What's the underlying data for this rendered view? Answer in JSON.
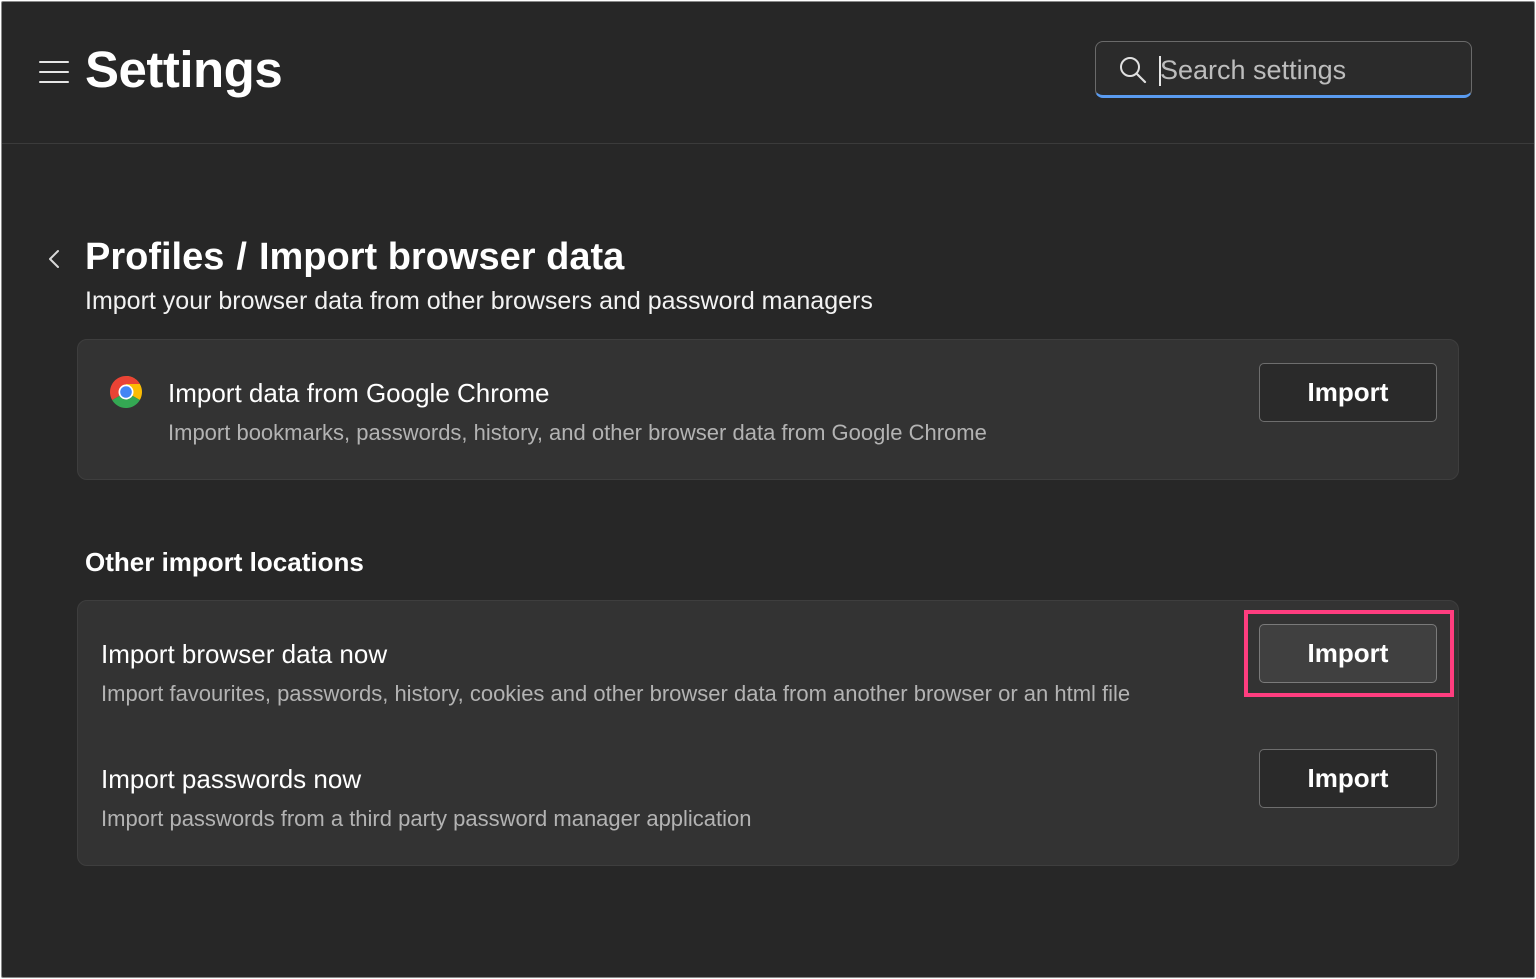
{
  "header": {
    "title": "Settings",
    "search": {
      "placeholder": "Search settings",
      "value": ""
    }
  },
  "page": {
    "breadcrumb": {
      "parent": "Profiles",
      "separator": "/",
      "current": "Import browser data"
    },
    "subtitle": "Import your browser data from other browsers and password managers"
  },
  "chrome_import": {
    "title": "Import data from Google Chrome",
    "description": "Import bookmarks, passwords, history, and other browser data from Google Chrome",
    "button_label": "Import"
  },
  "other_locations": {
    "heading": "Other import locations",
    "items": [
      {
        "title": "Import browser data now",
        "description": "Import favourites, passwords, history, cookies and other browser data from another browser or an html file",
        "button_label": "Import",
        "highlighted": true
      },
      {
        "title": "Import passwords now",
        "description": "Import passwords from a third party password manager application",
        "button_label": "Import",
        "highlighted": false
      }
    ]
  },
  "colors": {
    "background": "#272727",
    "card": "#333333",
    "search_underline": "#5a9bf0",
    "highlight": "#ff3d7f"
  },
  "icons": [
    "hamburger-menu-icon",
    "search-icon",
    "back-chevron-icon",
    "chrome-logo-icon"
  ]
}
